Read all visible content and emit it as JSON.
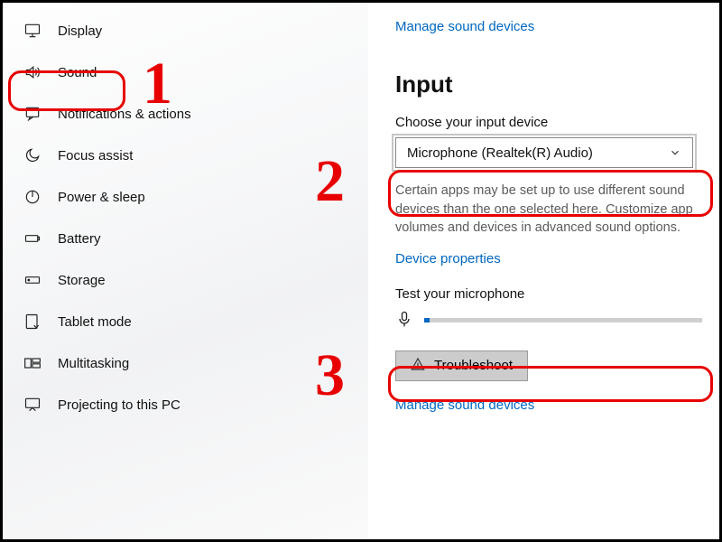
{
  "sidebar": {
    "items": [
      {
        "label": "Display"
      },
      {
        "label": "Sound"
      },
      {
        "label": "Notifications & actions"
      },
      {
        "label": "Focus assist"
      },
      {
        "label": "Power & sleep"
      },
      {
        "label": "Battery"
      },
      {
        "label": "Storage"
      },
      {
        "label": "Tablet mode"
      },
      {
        "label": "Multitasking"
      },
      {
        "label": "Projecting to this PC"
      }
    ]
  },
  "main": {
    "manage_link_top": "Manage sound devices",
    "input_heading": "Input",
    "choose_label": "Choose your input device",
    "dropdown_value": "Microphone (Realtek(R) Audio)",
    "description": "Certain apps may be set up to use different sound devices than the one selected here. Customize app volumes and devices in advanced sound options.",
    "device_props_link": "Device properties",
    "test_label": "Test your microphone",
    "troubleshoot_label": "Troubleshoot",
    "manage_link_bottom": "Manage sound devices"
  },
  "annotations": {
    "one": "1",
    "two": "2",
    "three": "3"
  }
}
